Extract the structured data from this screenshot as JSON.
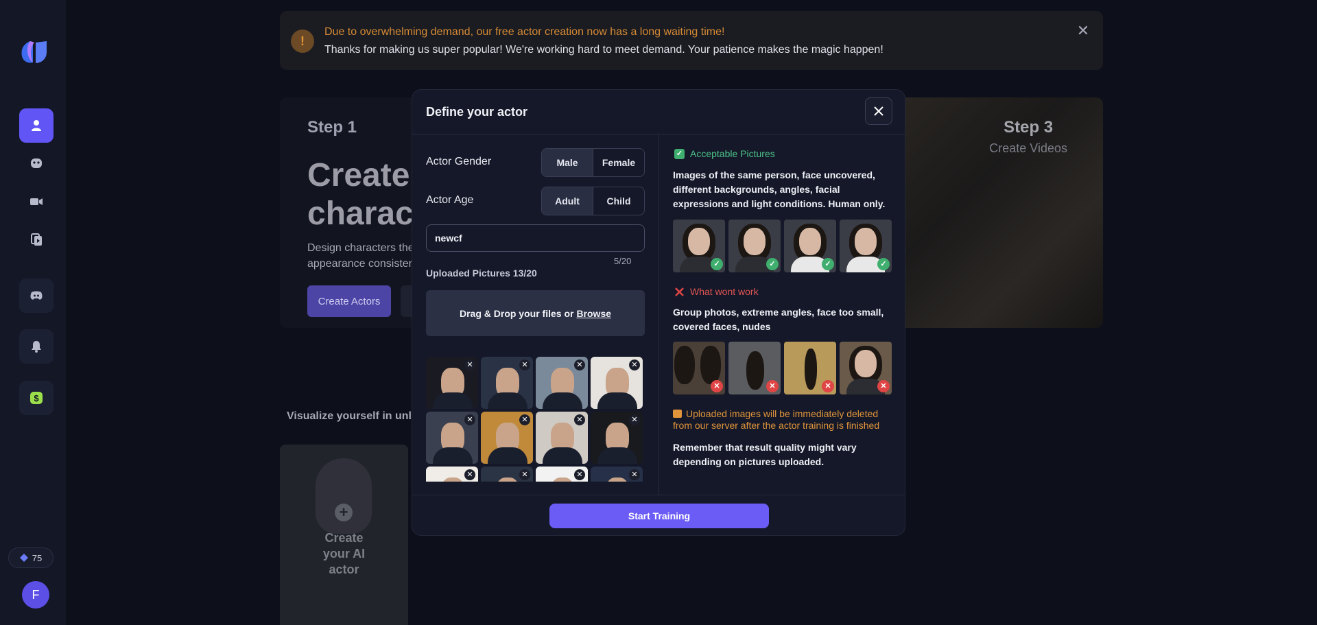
{
  "sidebar": {
    "credits": "75",
    "avatar_initial": "F"
  },
  "banner": {
    "line1": "Due to overwhelming demand, our free actor creation now has a long waiting time!",
    "line2": "Thanks for making us super popular! We're working hard to meet demand. Your patience makes the magic happen!",
    "icon_glyph": "!",
    "close_glyph": "✕"
  },
  "hero": {
    "step1": "Step 1",
    "title_line1": "Create",
    "title_line2": "charact",
    "desc_line1": "Design characters the",
    "desc_line2": "appearance consister",
    "create_button": "Create Actors",
    "step3": "Step 3",
    "step3_sub": "Create Videos"
  },
  "visualize_text": "Visualize yourself in unlim",
  "create_card": {
    "line1": "Create",
    "line2": "your AI",
    "line3": "actor"
  },
  "modal": {
    "title": "Define your actor",
    "gender_label": "Actor Gender",
    "gender_options": [
      "Male",
      "Female"
    ],
    "gender_selected": "Male",
    "age_label": "Actor Age",
    "age_options": [
      "Adult",
      "Child"
    ],
    "age_selected": "Adult",
    "name_value": "newcf",
    "name_counter": "5/20",
    "uploaded_label": "Uploaded Pictures 13/20",
    "dropzone_text": "Drag & Drop your files or",
    "dropzone_link": "Browse",
    "uploaded_count": 13,
    "good_title": "Acceptable Pictures",
    "good_desc": "Images of the same person, face uncovered, different backgrounds, angles, facial expressions and light conditions. Human only.",
    "bad_title": "What wont work",
    "bad_desc": "Group photos, extreme angles, face too small, covered faces, nudes",
    "warning": "Uploaded images will be immediately deleted from our server after the actor training is finished",
    "remember": "Remember that result quality might vary depending on pictures uploaded.",
    "start_button": "Start Training"
  },
  "colors": {
    "accent": "#6b5cf6",
    "good": "#3fae6e",
    "bad": "#e04545",
    "warning": "#e0953b"
  }
}
